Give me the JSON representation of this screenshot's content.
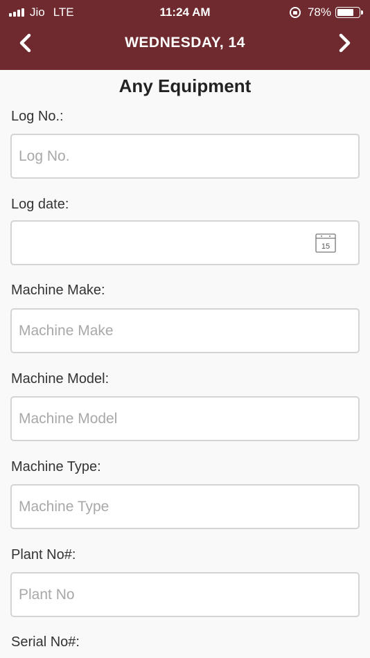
{
  "status_bar": {
    "carrier": "Jio",
    "network": "LTE",
    "time": "11:24 AM",
    "battery": "78%",
    "battery_level": 0.78
  },
  "nav": {
    "title": "WEDNESDAY,  14",
    "prev_icon": "chevron-left-icon",
    "next_icon": "chevron-right-icon"
  },
  "form": {
    "title": "Any Equipment",
    "fields": [
      {
        "label": "Log No.:",
        "placeholder": "Log No.",
        "value": ""
      },
      {
        "label": "Log date:",
        "placeholder": "",
        "value": "",
        "icon": "calendar-icon",
        "icon_text": "15"
      },
      {
        "label": "Machine Make:",
        "placeholder": "Machine Make",
        "value": ""
      },
      {
        "label": "Machine Model:",
        "placeholder": "Machine Model",
        "value": ""
      },
      {
        "label": "Machine Type:",
        "placeholder": "Machine Type",
        "value": ""
      },
      {
        "label": "Plant No#:",
        "placeholder": "Plant No",
        "value": ""
      },
      {
        "label": "Serial No#:"
      }
    ]
  },
  "colors": {
    "header_bg": "#6e2a2f",
    "page_bg": "#f9f9f9"
  }
}
